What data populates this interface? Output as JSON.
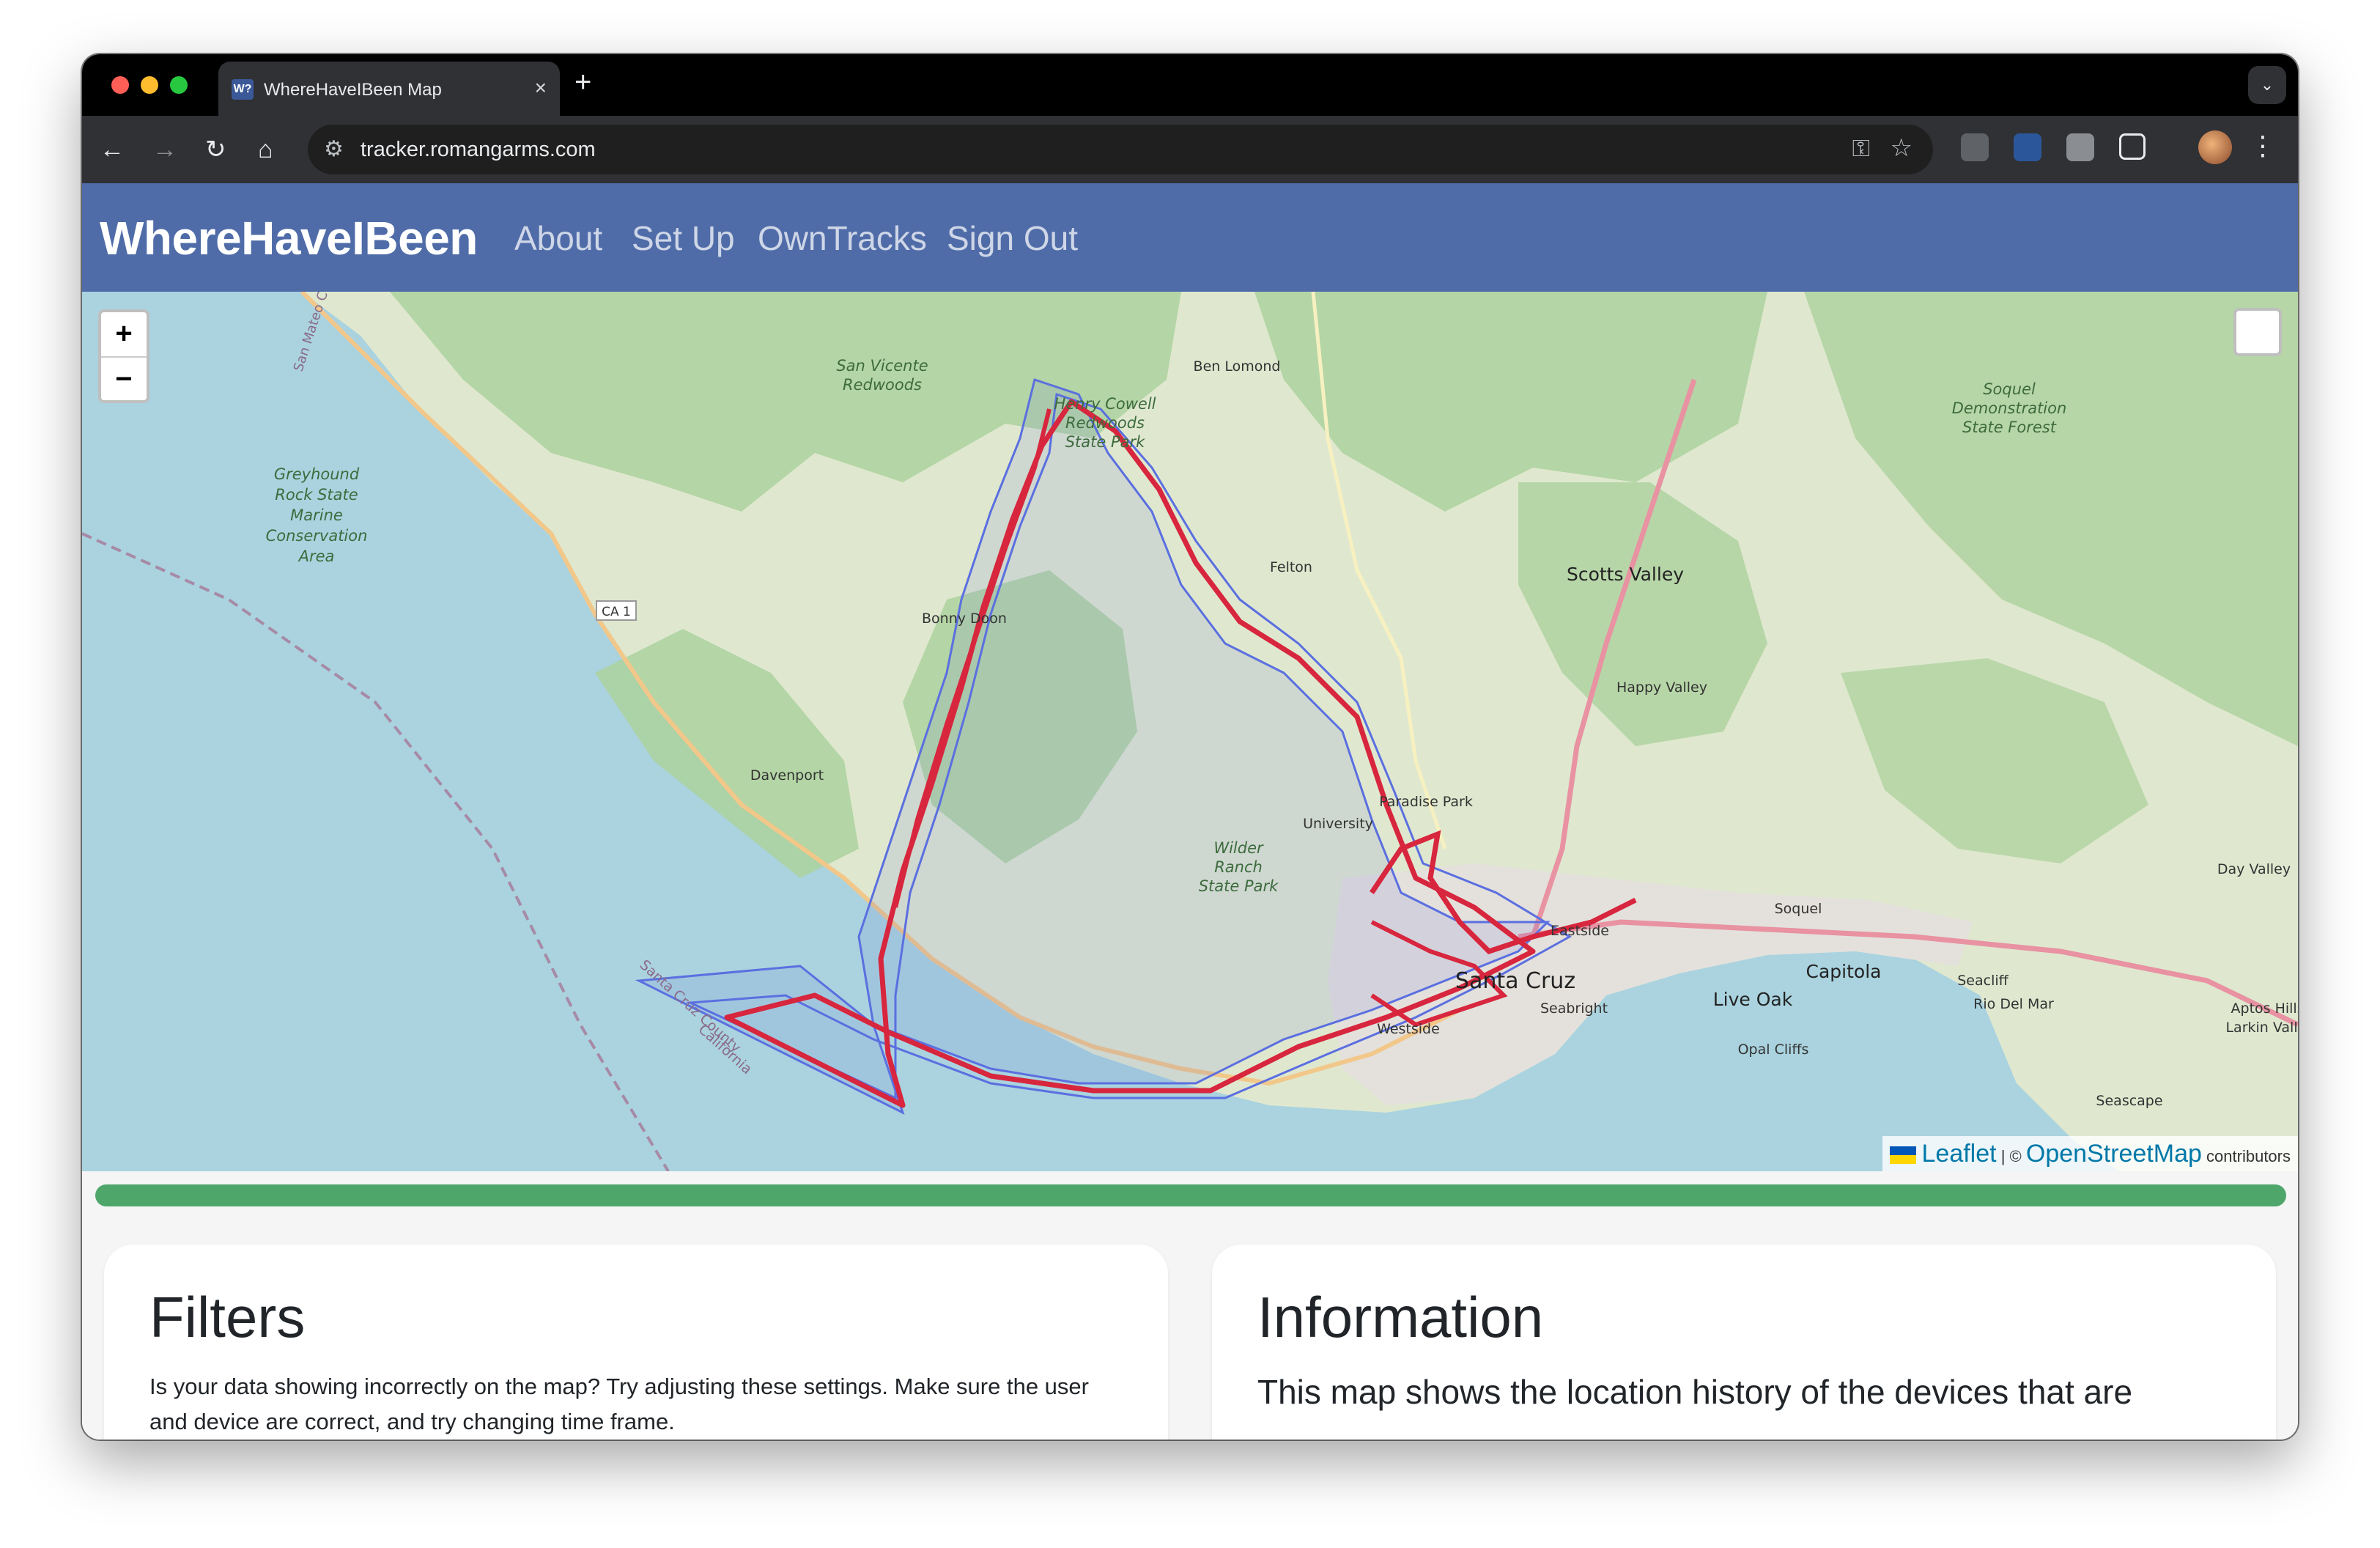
{
  "browser": {
    "tab_title": "WhereHaveIBeen Map",
    "favicon_text": "W?",
    "tab_close": "×",
    "new_tab": "+",
    "url": "tracker.romangarms.com"
  },
  "navbar": {
    "brand": "WhereHaveIBeen",
    "links": [
      "About",
      "Set Up",
      "OwnTracks",
      "Sign Out"
    ]
  },
  "map": {
    "zoom_in": "+",
    "zoom_out": "−",
    "attribution": {
      "leaflet": "Leaflet",
      "separator": "| ©",
      "osm": "OpenStreetMap",
      "contributors": "contributors"
    },
    "labels": {
      "san_vicente": [
        "San Vicente",
        "Redwoods"
      ],
      "henry_cowell": [
        "Henry Cowell",
        "Redwoods",
        "State Park"
      ],
      "soquel_demo": [
        "Soquel",
        "Demonstration",
        "State Forest"
      ],
      "greyhound": [
        "Greyhound",
        "Rock State",
        "Marine",
        "Conservation",
        "Area"
      ],
      "wilder": [
        "Wilder",
        "Ranch",
        "State Park"
      ],
      "ben_lomond": "Ben Lomond",
      "felton": "Felton",
      "scotts_valley": "Scotts Valley",
      "bonny_doon": "Bonny Doon",
      "happy_valley": "Happy Valley",
      "davenport": "Davenport",
      "paradise_park": "Paradise Park",
      "university": "University",
      "santa_cruz": "Santa Cruz",
      "eastside": "Eastside",
      "seabright": "Seabright",
      "live_oak": "Live Oak",
      "soquel": "Soquel",
      "capitola": "Capitola",
      "opal_cliffs": "Opal Cliffs",
      "seacliff": "Seacliff",
      "rio_del_mar": "Rio Del Mar",
      "day_valley": "Day Valley",
      "aptos_hills": [
        "Aptos Hills-",
        "Larkin Valley"
      ],
      "seascape": "Seascape",
      "westside": "Westside",
      "ca1": "CA 1",
      "santa_cruz_county": "Santa Cruz County",
      "california": "California",
      "san_mateo": "San Mateo C..."
    }
  },
  "progress": 1.0,
  "filters": {
    "title": "Filters",
    "description": "Is your data showing incorrectly on the map? Try adjusting these settings. Make sure the user and device are correct, and try changing time frame."
  },
  "information": {
    "title": "Information",
    "description": "This map shows the location history of the devices that are"
  },
  "colors": {
    "navbar": "#4f6ca8",
    "progress": "#4fa66b",
    "track": "#d7263d",
    "track_halo": "#5b6fe0",
    "water": "#aad3df",
    "forest": "#add19e"
  }
}
